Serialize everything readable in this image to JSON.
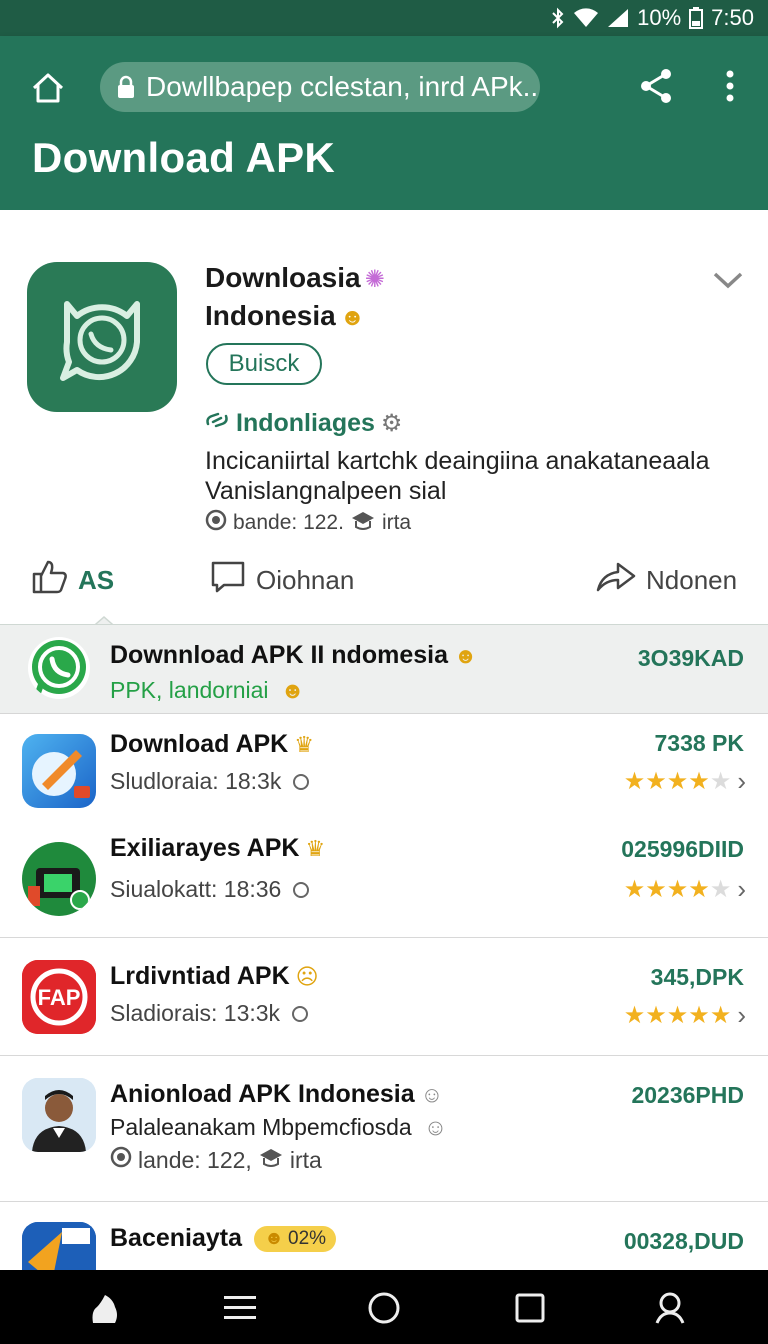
{
  "status_bar": {
    "battery": "10%",
    "time": "7:50"
  },
  "app_bar": {
    "url_text": "Dowllbapep cclestan, inrd APk..",
    "title": "Download APK"
  },
  "featured": {
    "name_line1": "Downloasia",
    "name_line2": "Indonesia",
    "install_label": "Buisck",
    "tag_label": "Indonliages",
    "description": "Incicaniirtal kartchk deaingiina anakataneaala Vanislangnalpeen sial",
    "meta": "bande: 122.",
    "meta_suffix": "irta",
    "actions": {
      "like_label": "AS",
      "comment_label": "Oiohnan",
      "share_label": "Ndonen"
    }
  },
  "list": [
    {
      "title": "Downnload APK II ndomesia",
      "subtitle": "PPK, landorniai",
      "size": "3O39KAD"
    },
    {
      "title": "Download APK",
      "subtitle": "Sludloraia: 18:3k",
      "size": "7338 PK",
      "rating": 3.5
    },
    {
      "title": "Exiliarayes APK",
      "subtitle": "Siualokatt: 18:36",
      "size": "025996DIID",
      "rating": 3.5
    },
    {
      "title": "Lrdivntiad APK",
      "subtitle": "Sladiorais: 13:3k",
      "size": "345,DPK",
      "rating": 4.5
    },
    {
      "title": "Anionload APK Indonesia",
      "subtitle": "Palaleanakam Mbpemcfiosda",
      "meta": "lande: 122,",
      "meta_suffix": "irta",
      "size": "20236PHD"
    },
    {
      "title": "Baceniayta",
      "badge": "02%",
      "size": "00328,DUD"
    }
  ],
  "colors": {
    "primary": "#24755a",
    "status_bar": "#1f5c45",
    "star": "#f2b11f"
  },
  "icons": {
    "nav": [
      "back-icon",
      "menu-icon",
      "home-circle-icon",
      "recents-icon",
      "search-icon"
    ]
  }
}
